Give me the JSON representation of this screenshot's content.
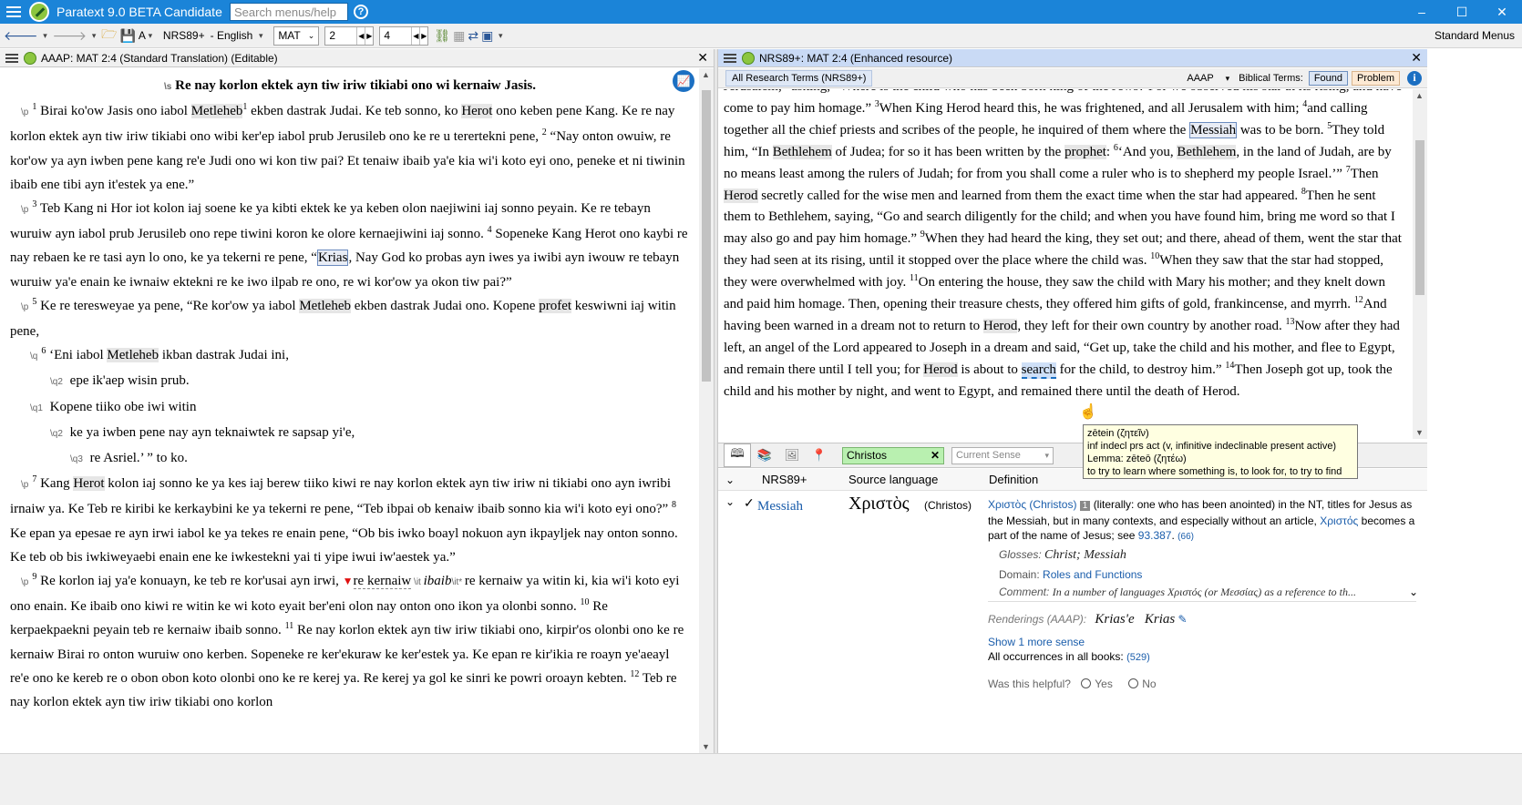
{
  "app": {
    "title": "Paratext 9.0 BETA Candidate",
    "search_placeholder": "Search menus/help",
    "minimize": "–",
    "maximize": "☐",
    "close": "✕"
  },
  "toolbar": {
    "font_label": "A",
    "project": "NRS89+",
    "language": "- English",
    "book": "MAT",
    "chapter": "2",
    "verse": "4",
    "menus_label": "Standard Menus"
  },
  "left_pane": {
    "title": "AAAP: MAT 2:4 (Standard Translation) (Editable)",
    "heading_marker": "\\s",
    "heading": "Re nay korlon ektek ayn tiw iriw tikiabi ono wi kernaiw Jasis.",
    "lines": [
      {
        "marker": "\\p",
        "segments": [
          {
            "v": "1"
          },
          {
            "t": " Birai ko'ow Jasis ono iabol "
          },
          {
            "h": "Metleheb"
          },
          {
            "sup": "1"
          },
          {
            "t": " ekben dastrak Judai. Ke teb sonno, ko "
          },
          {
            "h": "Herot"
          },
          {
            "t": " ono keben pene Kang. Ke re nay korlon ektek ayn tiw iriw tikiabi ono wibi ker'ep iabol prub Jerusileb ono ke re u terertekni pene, "
          },
          {
            "v": "2"
          },
          {
            "t": " “Nay onton owuiw, re kor'ow ya ayn iwben pene kang re'e Judi ono wi kon tiw pai? Et tenaiw ibaib ya'e kia wi'i koto eyi ono, peneke et ni tiwinin ibaib ene tibi ayn it'estek ya ene.”"
          }
        ]
      },
      {
        "marker": "\\p",
        "segments": [
          {
            "v": "3"
          },
          {
            "t": " Teb Kang ni Hor iot kolon iaj soene ke ya kibti ektek ke ya keben olon naejiwini iaj sonno peyain. Ke re tebayn wuruiw ayn iabol prub Jerusileb ono repe tiwini koron ke olore kernaejiwini iaj sonno. "
          },
          {
            "v": "4"
          },
          {
            "t": " Sopeneke Kang Herot ono kaybi re nay rebaen ke re tasi ayn lo ono, ke ya tekerni re pene, “"
          },
          {
            "hb": "Krias"
          },
          {
            "t": ", Nay God ko probas ayn iwes ya iwibi ayn iwouw re tebayn wuruiw ya'e enain ke iwnaiw ektekni re ke iwo ilpab re ono, re wi kor'ow ya okon tiw pai?”"
          }
        ]
      },
      {
        "marker": "\\p",
        "segments": [
          {
            "v": "5"
          },
          {
            "t": " Ke re teresweyae ya pene, “Re kor'ow ya iabol "
          },
          {
            "h": "Metleheb"
          },
          {
            "t": " ekben dastrak Judai ono. Kopene "
          },
          {
            "h": "profet"
          },
          {
            "t": " keswiwni iaj witin pene,"
          }
        ]
      },
      {
        "marker": "\\q",
        "indent": 22,
        "segments": [
          {
            "v": "6"
          },
          {
            "t": " ‘Eni iabol "
          },
          {
            "h": "Metleheb"
          },
          {
            "t": " ikban dastrak Judai ini,"
          }
        ]
      },
      {
        "marker": "\\q2",
        "indent": 44,
        "segments": [
          {
            "t": " epe ik'aep wisin prub."
          }
        ]
      },
      {
        "marker": "\\q1",
        "indent": 22,
        "segments": [
          {
            "t": " Kopene tiiko obe iwi witin"
          }
        ]
      },
      {
        "marker": "\\q2",
        "indent": 44,
        "segments": [
          {
            "t": " ke ya iwben pene nay ayn teknaiwtek re sapsap yi'e,"
          }
        ]
      },
      {
        "marker": "\\q3",
        "indent": 66,
        "segments": [
          {
            "t": " re Asriel.’ ” to ko."
          }
        ]
      },
      {
        "marker": "\\p",
        "segments": [
          {
            "v": "7"
          },
          {
            "t": " Kang "
          },
          {
            "h": "Herot"
          },
          {
            "t": " kolon iaj sonno ke ya kes iaj berew tiiko kiwi re nay korlon ektek ayn tiw iriw ni tikiabi ono ayn iwribi irnaiw ya. Ke Teb re kiribi ke kerkaybini ke ya tekerni re pene, “Teb ibpai ob kenaiw ibaib sonno kia wi'i koto eyi ono?” "
          },
          {
            "v": "8"
          },
          {
            "t": " Ke epan ya epesae re ayn irwi iabol ke ya tekes re enain pene, “Ob bis iwko boayl nokuon ayn ikpayljek nay onton sonno. Ke teb ob bis iwkiweyaebi enain ene ke iwkestekni yai ti yipe iwui iw'aestek ya.”"
          }
        ]
      },
      {
        "marker": "\\p",
        "segments": [
          {
            "v": "9"
          },
          {
            "t": " Re korlon iaj ya'e konuayn, ke teb re kor'usai ayn irwi, "
          },
          {
            "flag": "▼"
          },
          {
            "u": "re kernaiw"
          },
          {
            "mk": " \\it "
          },
          {
            "it": "ibaib"
          },
          {
            "mk": "\\it* "
          },
          {
            "t": "re kernaiw ya witin ki, kia wi'i koto eyi ono enain. Ke ibaib ono kiwi re witin ke wi koto eyait ber'eni olon nay onton ono ikon ya olonbi sonno. "
          },
          {
            "v": "10"
          },
          {
            "t": " Re kerpaekpaekni peyain teb re kernaiw ibaib sonno. "
          },
          {
            "v": "11"
          },
          {
            "t": " Re nay korlon ektek ayn tiw iriw tikiabi ono, kirpir'os olonbi ono ke re kernaiw Birai ro onton wuruiw ono kerben. Sopeneke re ker'ekuraw ke ker'estek ya. Ke epan re kir'ikia re roayn ye'aeayl re'e ono ke kereb re o obon obon koto olonbi ono ke re kerej ya. Re kerej ya gol ke sinri ke powri oroayn kebten. "
          },
          {
            "v": "12"
          },
          {
            "t": " Teb re nay korlon ektek ayn tiw iriw tikiabi ono korlon"
          }
        ]
      }
    ]
  },
  "right_pane": {
    "title": "NRS89+: MAT 2:4 (Enhanced resource)",
    "research_terms_button": "All Research Terms (NRS89+)",
    "project_select": "AAAP",
    "biblical_terms_label": "Biblical Terms:",
    "found_button": "Found",
    "problem_button": "Problem",
    "text_segments": [
      {
        "t": "Jerusalem, “asking, “Where is the child who has been born king of the Jews? For we observed his star at its rising, and have come to pay him homage.” "
      },
      {
        "v": "3"
      },
      {
        "t": "When King Herod heard this, he was frightened, and all Jerusalem with him; "
      },
      {
        "v": "4"
      },
      {
        "t": "and calling together all the chief priests and scribes of the people, he inquired of them where the "
      },
      {
        "hb": "Messiah"
      },
      {
        "t": " was to be born. "
      },
      {
        "v": "5"
      },
      {
        "t": "They told him, “In "
      },
      {
        "h": "Bethlehem"
      },
      {
        "t": " of Judea; for so it has been written by the "
      },
      {
        "h": "prophet"
      },
      {
        "t": ": "
      },
      {
        "v": "6"
      },
      {
        "t": "‘And you, "
      },
      {
        "h": "Bethlehem"
      },
      {
        "t": ", in the land of Judah, are by no means least among the rulers of Judah; for from you shall come a ruler who is to shepherd my people Israel.’” "
      },
      {
        "v": "7"
      },
      {
        "t": "Then "
      },
      {
        "h": "Herod"
      },
      {
        "t": " secretly called for the wise men and learned from them the exact time when the star had appeared. "
      },
      {
        "v": "8"
      },
      {
        "t": "Then he sent them to Bethlehem, saying, “Go and search diligently for the child; and when you have found him, bring me word so that I may also go and pay him homage.” "
      },
      {
        "v": "9"
      },
      {
        "t": "When they had heard the king, they set out; and there, ahead of them, went the star that they had seen at its rising, until it stopped over the place where the child was. "
      },
      {
        "v": "10"
      },
      {
        "t": "When they saw that the star had stopped, they were overwhelmed with joy. "
      },
      {
        "v": "11"
      },
      {
        "t": "On entering the house, they saw the child with Mary his mother; and they knelt down and paid him homage. Then, opening their treasure chests, they offered him gifts of gold, frankincense, and myrrh. "
      },
      {
        "v": "12"
      },
      {
        "t": "And having been warned in a dream not to return to "
      },
      {
        "h": "Herod"
      },
      {
        "t": ", they left for their own country by another road. "
      },
      {
        "v": "13"
      },
      {
        "t": "Now after they had left, an angel of the Lord appeared to Joseph in a dream and said, “Get up, take the child and his mother, and flee to Egypt, and remain there until I tell you; for "
      },
      {
        "h": "Herod"
      },
      {
        "t": " is about to "
      },
      {
        "hs": "search"
      },
      {
        "t": " for the child, to destroy him.” "
      },
      {
        "v": "14"
      },
      {
        "t": "Then Joseph got up, took the child and his mother by night, and went to Egypt, and remained there until the death of Herod."
      }
    ],
    "tooltip": {
      "line1": "zētein (ζητεῖν)",
      "line2": "inf indecl prs act (v, infinitive indeclinable present active)",
      "line3": "Lemma: zēteō (ζητέω)",
      "line4": "to try to learn where something is, to look for, to try to find"
    },
    "term_search_value": "Christos",
    "sense_select": "Current Sense",
    "columns": {
      "project": "NRS89+",
      "source": "Source language",
      "definition": "Definition"
    },
    "term": {
      "check": "✓",
      "rendering": "Messiah",
      "greek": "Χριστὸς",
      "translit": "(Christos)",
      "def_link": "Χριστὸς (Christos)",
      "def_badge": "1",
      "def_text1": "(literally: one who has been anointed) in the NT, titles for Jesus as the Messiah, but in many contexts, and especially without an article,",
      "def_link2": "Χριστός",
      "def_text2": "becomes a part of the name of Jesus; see",
      "def_ref": "93.387",
      "def_count": "(66)",
      "glosses_label": "Glosses:",
      "glosses": "Christ; Messiah",
      "domain_label": "Domain:",
      "domain": "Roles and Functions",
      "comment_label": "Comment:",
      "comment": "In a number of languages Χριστός (or Μεσσίας) as a reference to th...",
      "renderings_label": "Renderings (AAAP):",
      "renderings": "Krias'e   Krias",
      "more_sense": "Show 1 more sense",
      "all_occ": "All occurrences in all books:",
      "all_occ_count": "(529)",
      "helpful": "Was this helpful?",
      "yes": "Yes",
      "no": "No"
    }
  }
}
